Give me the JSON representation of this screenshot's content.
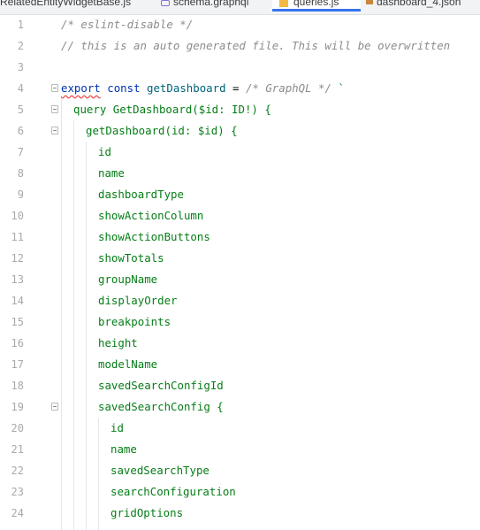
{
  "tabs": [
    {
      "label": "RelatedEntityWidgetBase.js",
      "active": false
    },
    {
      "label": "schema.graphql",
      "active": false
    },
    {
      "label": "queries.js",
      "active": true
    },
    {
      "label": "dashboard_4.json",
      "active": false
    }
  ],
  "editor": {
    "colors": {
      "comment": "#8c8c8c",
      "keyword": "#0033b3",
      "function": "#00627a",
      "graphql": "#067d17",
      "line_number": "#a7a9ad",
      "active_tab_underline": "#3574f0"
    },
    "lines": [
      {
        "n": "1",
        "fold": false,
        "text": "/* eslint-disable */"
      },
      {
        "n": "2",
        "fold": false,
        "text": "// this is an auto generated file. This will be overwritten"
      },
      {
        "n": "3",
        "fold": false,
        "text": ""
      },
      {
        "n": "4",
        "fold": true,
        "text": "export const getDashboard = /* GraphQL */ `"
      },
      {
        "n": "5",
        "fold": true,
        "text": "query GetDashboard($id: ID!) {"
      },
      {
        "n": "6",
        "fold": true,
        "text": "getDashboard(id: $id) {"
      },
      {
        "n": "7",
        "fold": false,
        "text": "id"
      },
      {
        "n": "8",
        "fold": false,
        "text": "name"
      },
      {
        "n": "9",
        "fold": false,
        "text": "dashboardType"
      },
      {
        "n": "10",
        "fold": false,
        "text": "showActionColumn"
      },
      {
        "n": "11",
        "fold": false,
        "text": "showActionButtons"
      },
      {
        "n": "12",
        "fold": false,
        "text": "showTotals"
      },
      {
        "n": "13",
        "fold": false,
        "text": "groupName"
      },
      {
        "n": "14",
        "fold": false,
        "text": "displayOrder"
      },
      {
        "n": "15",
        "fold": false,
        "text": "breakpoints"
      },
      {
        "n": "16",
        "fold": false,
        "text": "height"
      },
      {
        "n": "17",
        "fold": false,
        "text": "modelName"
      },
      {
        "n": "18",
        "fold": false,
        "text": "savedSearchConfigId"
      },
      {
        "n": "19",
        "fold": true,
        "text": "savedSearchConfig {"
      },
      {
        "n": "20",
        "fold": false,
        "text": "id"
      },
      {
        "n": "21",
        "fold": false,
        "text": "name"
      },
      {
        "n": "22",
        "fold": false,
        "text": "savedSearchType"
      },
      {
        "n": "23",
        "fold": false,
        "text": "searchConfiguration"
      },
      {
        "n": "24",
        "fold": false,
        "text": "gridOptions"
      }
    ]
  }
}
